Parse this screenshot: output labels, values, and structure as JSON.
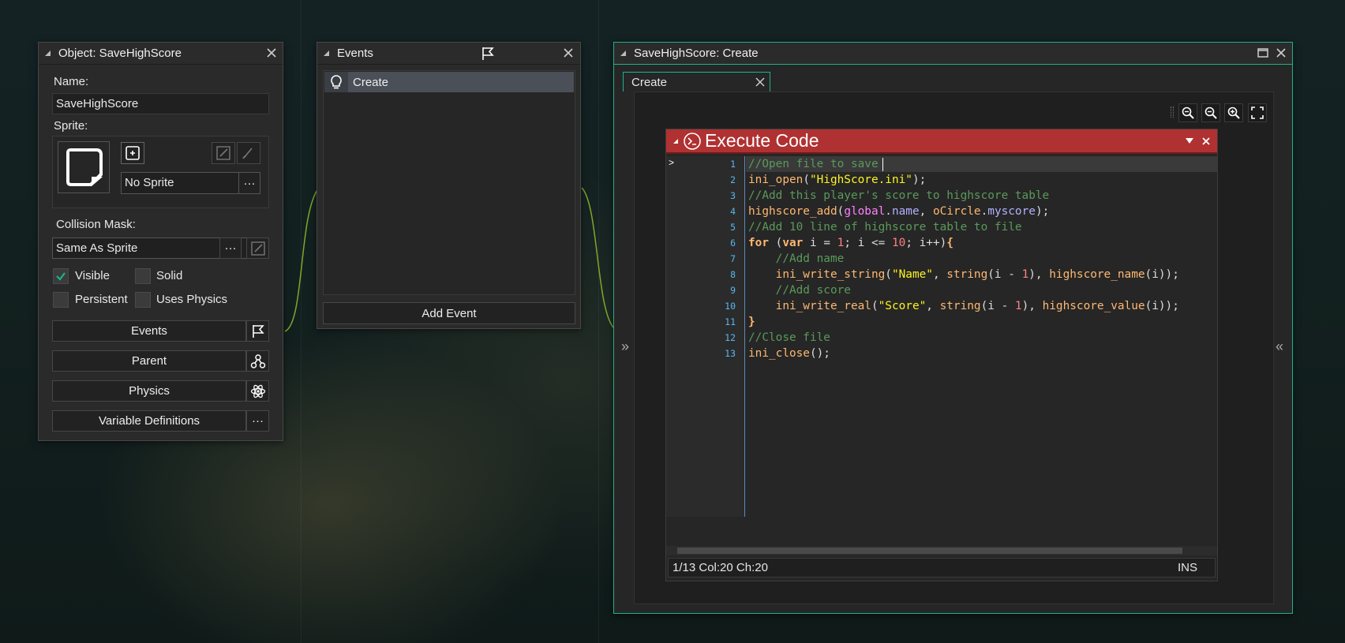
{
  "colors": {
    "accent": "#1cb38a",
    "execute_header": "#b03131",
    "selected_row": "#4a4f58",
    "line_number": "#58b7f2"
  },
  "object_panel": {
    "title": "Object: SaveHighScore",
    "name_label": "Name:",
    "name_value": "SaveHighScore",
    "sprite_label": "Sprite:",
    "sprite_value": "No Sprite",
    "sprite_more": "···",
    "collision_label": "Collision Mask:",
    "collision_value": "Same As Sprite",
    "collision_more": "···",
    "checkboxes": [
      {
        "label": "Visible",
        "checked": true
      },
      {
        "label": "Solid",
        "checked": false
      },
      {
        "label": "Persistent",
        "checked": false
      },
      {
        "label": "Uses Physics",
        "checked": false
      }
    ],
    "buttons": [
      {
        "label": "Events",
        "icon": "flag-icon"
      },
      {
        "label": "Parent",
        "icon": "parent-icon"
      },
      {
        "label": "Physics",
        "icon": "atom-icon"
      },
      {
        "label": "Variable Definitions",
        "icon": "ellipsis-icon",
        "icon_text": "···"
      }
    ]
  },
  "events_panel": {
    "title": "Events",
    "events": [
      {
        "label": "Create",
        "icon": "lightbulb-icon",
        "selected": true
      }
    ],
    "add_event_label": "Add Event"
  },
  "code_window": {
    "title": "SaveHighScore: Create",
    "tab": "Create",
    "action_title": "Execute Code",
    "status": "1/13 Col:20 Ch:20",
    "mode": "INS",
    "left_collapse": "»",
    "right_collapse": "«",
    "lines": [
      [
        [
          "c-com",
          "//Open file to save"
        ]
      ],
      [
        [
          "c-fn",
          "ini_open"
        ],
        [
          "c-txt",
          "("
        ],
        [
          "c-str",
          "\"HighScore.ini\""
        ],
        [
          "c-txt",
          ");"
        ]
      ],
      [
        [
          "c-com",
          "//Add this player's score to highscore table"
        ]
      ],
      [
        [
          "c-fn",
          "highscore_add"
        ],
        [
          "c-txt",
          "("
        ],
        [
          "c-glob",
          "global"
        ],
        [
          "c-txt",
          "."
        ],
        [
          "c-inst",
          "name"
        ],
        [
          "c-txt",
          ", "
        ],
        [
          "c-res",
          "oCircle"
        ],
        [
          "c-txt",
          "."
        ],
        [
          "c-inst",
          "myscore"
        ],
        [
          "c-txt",
          ");"
        ]
      ],
      [
        [
          "c-com",
          "//Add 10 line of highscore table to file"
        ]
      ],
      [
        [
          "c-kw",
          "for"
        ],
        [
          "c-txt",
          " ("
        ],
        [
          "c-kw",
          "var"
        ],
        [
          "c-txt",
          " i = "
        ],
        [
          "c-num",
          "1"
        ],
        [
          "c-txt",
          "; i <= "
        ],
        [
          "c-num",
          "10"
        ],
        [
          "c-txt",
          "; i++)"
        ],
        [
          "c-kw",
          "{"
        ]
      ],
      [
        [
          "c-txt",
          "    "
        ],
        [
          "c-com",
          "//Add name"
        ]
      ],
      [
        [
          "c-txt",
          "    "
        ],
        [
          "c-fn",
          "ini_write_string"
        ],
        [
          "c-txt",
          "("
        ],
        [
          "c-str",
          "\"Name\""
        ],
        [
          "c-txt",
          ", "
        ],
        [
          "c-fn",
          "string"
        ],
        [
          "c-txt",
          "(i - "
        ],
        [
          "c-num",
          "1"
        ],
        [
          "c-txt",
          "), "
        ],
        [
          "c-fn",
          "highscore_name"
        ],
        [
          "c-txt",
          "(i));"
        ]
      ],
      [
        [
          "c-txt",
          "    "
        ],
        [
          "c-com",
          "//Add score"
        ]
      ],
      [
        [
          "c-txt",
          "    "
        ],
        [
          "c-fn",
          "ini_write_real"
        ],
        [
          "c-txt",
          "("
        ],
        [
          "c-str",
          "\"Score\""
        ],
        [
          "c-txt",
          ", "
        ],
        [
          "c-fn",
          "string"
        ],
        [
          "c-txt",
          "(i - "
        ],
        [
          "c-num",
          "1"
        ],
        [
          "c-txt",
          "), "
        ],
        [
          "c-fn",
          "highscore_value"
        ],
        [
          "c-txt",
          "(i));"
        ]
      ],
      [
        [
          "c-kw",
          "}"
        ]
      ],
      [
        [
          "c-com",
          "//Close file"
        ]
      ],
      [
        [
          "c-fn",
          "ini_close"
        ],
        [
          "c-txt",
          "();"
        ]
      ]
    ],
    "line_numbers": [
      "1",
      "2",
      "3",
      "4",
      "5",
      "6",
      "7",
      "8",
      "9",
      "10",
      "11",
      "12",
      "13"
    ]
  }
}
